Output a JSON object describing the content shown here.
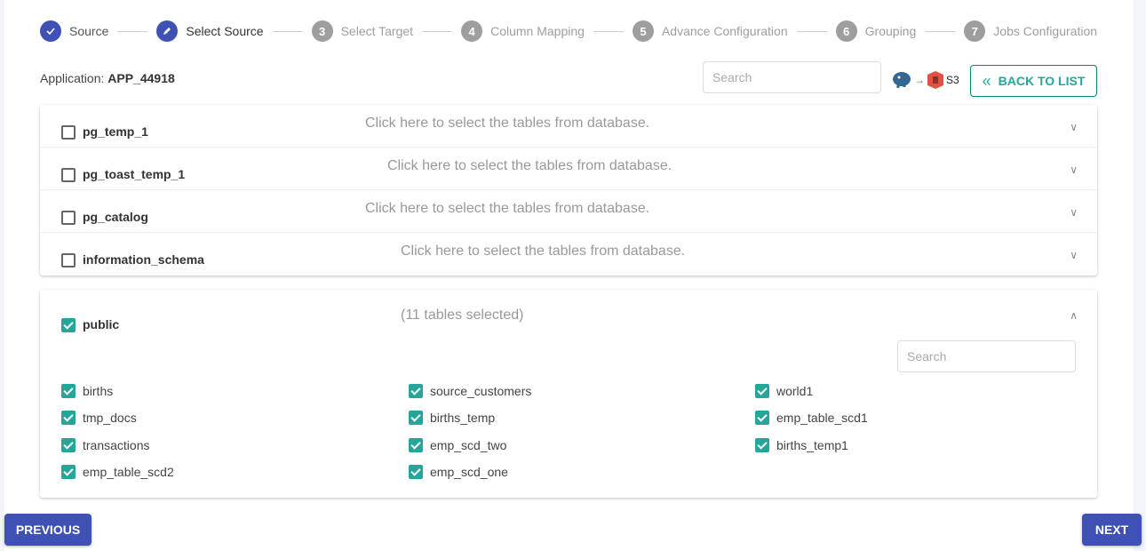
{
  "stepper": [
    {
      "num": "",
      "label": "Source",
      "state": "done",
      "icon": "check-icon"
    },
    {
      "num": "",
      "label": "Select Source",
      "state": "current",
      "icon": "pencil-icon"
    },
    {
      "num": "3",
      "label": "Select Target",
      "state": "pending"
    },
    {
      "num": "4",
      "label": "Column Mapping",
      "state": "pending"
    },
    {
      "num": "5",
      "label": "Advance Configuration",
      "state": "pending"
    },
    {
      "num": "6",
      "label": "Grouping",
      "state": "pending"
    },
    {
      "num": "7",
      "label": "Jobs Configuration",
      "state": "pending"
    }
  ],
  "header": {
    "app_label": "Application:",
    "app_name": "APP_44918",
    "search_placeholder": "Search",
    "connection_source_icon": "postgresql-icon",
    "connection_arrow": "→",
    "connection_target_icon": "aws-s3-icon",
    "connection_target": "S3",
    "back_label": "BACK TO LIST"
  },
  "schemas": [
    {
      "name": "pg_temp_1",
      "hint": "Click here to select the tables from database.",
      "checked": false
    },
    {
      "name": "pg_toast_temp_1",
      "hint": "Click here to select the tables from database.",
      "checked": false
    },
    {
      "name": "pg_catalog",
      "hint": "Click here to select the tables from database.",
      "checked": false
    },
    {
      "name": "information_schema",
      "hint": "Click here to select the tables from database.",
      "checked": false
    }
  ],
  "public": {
    "name": "public",
    "hint": "(11 tables selected)",
    "checked": true,
    "search_placeholder": "Search",
    "tables": [
      "births",
      "source_customers",
      "world1",
      "tmp_docs",
      "births_temp",
      "emp_table_scd1",
      "transactions",
      "emp_scd_two",
      "births_temp1",
      "emp_table_scd2",
      "emp_scd_one"
    ]
  },
  "footer": {
    "previous": "PREVIOUS",
    "next": "NEXT"
  },
  "colors": {
    "primary": "#3f51b5",
    "teal": "#26a69a",
    "pending": "#9e9e9e"
  }
}
